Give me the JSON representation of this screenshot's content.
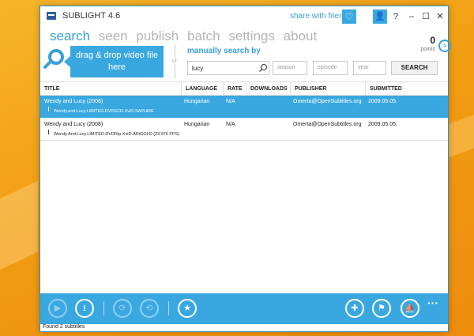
{
  "window": {
    "title": "SUBLIGHT 4.6",
    "share_label": "share with friends",
    "controls": [
      "?",
      "–",
      "☐",
      "✕"
    ]
  },
  "nav": {
    "tabs": [
      "search",
      "seen",
      "publish",
      "batch",
      "settings",
      "about"
    ],
    "active": "search"
  },
  "points": {
    "value": "0",
    "label": "points"
  },
  "search": {
    "drop_label_line1": "drag & drop video file",
    "drop_label_line2": "here",
    "or_label": "or",
    "manual_label": "manually search by",
    "query_value": "lucy",
    "season_placeholder": "season",
    "episode_placeholder": "episode",
    "year_placeholder": "year",
    "search_button": "SEARCH"
  },
  "table": {
    "columns": [
      "TITLE",
      "LANGUAGE",
      "RATE",
      "DOWNLOADS",
      "PUBLISHER",
      "SUBMITTED"
    ],
    "rows": [
      {
        "title": "Wendy and Lucy (2008)",
        "language": "Hungarian",
        "rate": "N/A",
        "downloads": "",
        "publisher": "Omerta@OpenSubtitles.org",
        "submitted": "2009.05.05.",
        "release": "Wendy.and.Lucy.LIMITED.DVDSCR.XviD-SAPHiRE",
        "selected": true
      },
      {
        "title": "Wendy and Lucy (2008)",
        "language": "Hungarian",
        "rate": "N/A",
        "downloads": "",
        "publisher": "Omerta@OpenSubtitles.org",
        "submitted": "2009.05.05.",
        "release": "Wendy.And.Lucy.LIMITED.DVDRip.XviD-ARiGOLD (23.976 FPS)",
        "selected": false
      }
    ]
  },
  "toolbar": {
    "icons": [
      "play-icon",
      "download-icon",
      "sync-icon",
      "sync-alt-icon",
      "star-icon",
      "puzzle-icon",
      "flag-icon",
      "sail-icon",
      "more-icon"
    ]
  },
  "status": {
    "text": "Found 2 subtitles"
  },
  "colors": {
    "accent": "#3aa8e0",
    "desktop": "#f3a318"
  }
}
